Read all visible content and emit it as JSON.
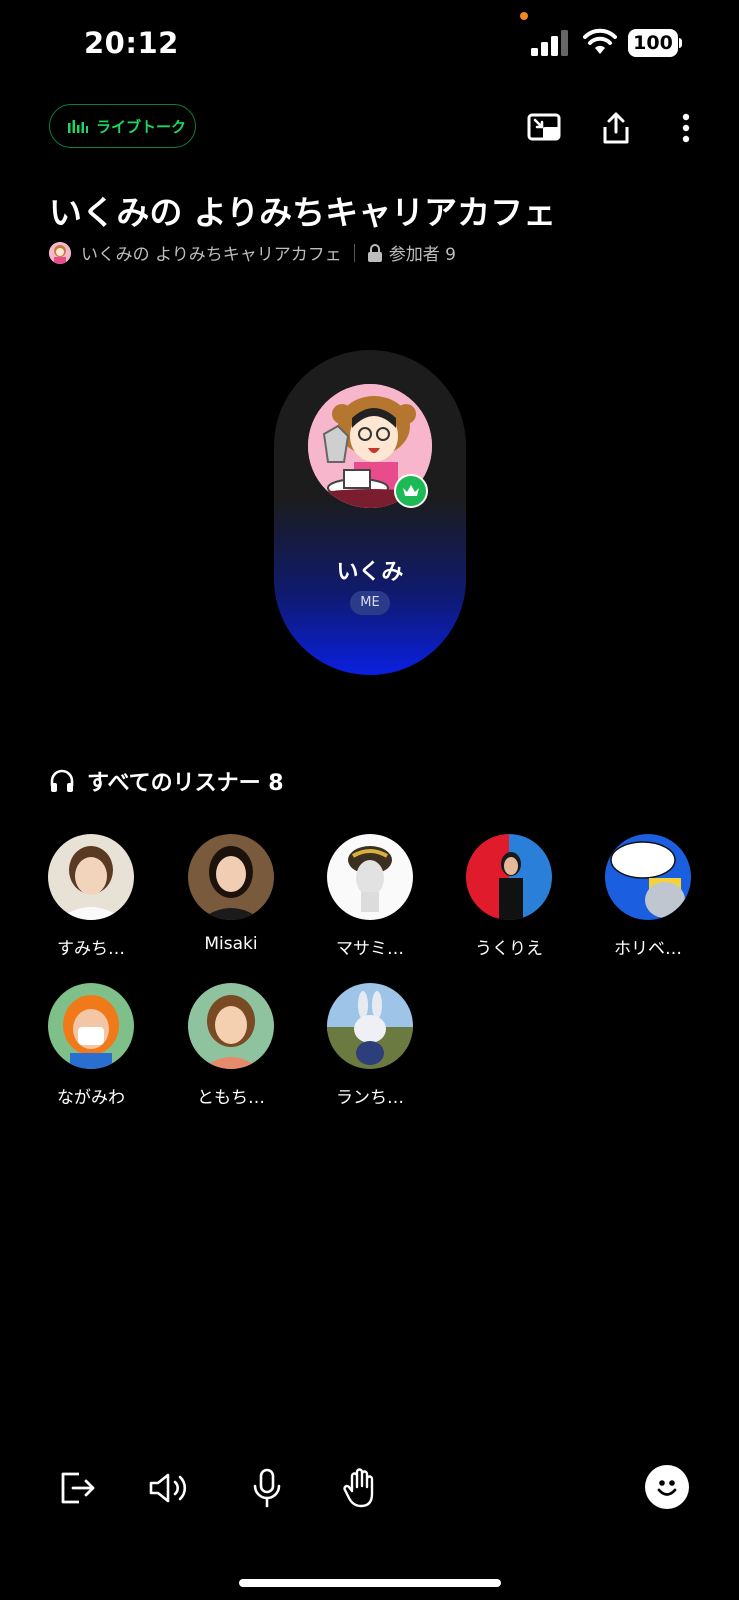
{
  "status_bar": {
    "time": "20:12",
    "battery": "100"
  },
  "header": {
    "live_badge": "ライブトーク",
    "room_title": "いくみの よりみちキャリアカフェ",
    "host_name": "いくみの よりみちキャリアカフェ",
    "participants": "参加者 9"
  },
  "speaker": {
    "name": "いくみ",
    "badge": "ME"
  },
  "listeners": {
    "heading": "すべてのリスナー 8",
    "items": [
      {
        "name": "すみち…"
      },
      {
        "name": "Misaki"
      },
      {
        "name": "マサミ…"
      },
      {
        "name": "うくりえ"
      },
      {
        "name": "ホリベ…"
      },
      {
        "name": "ながみわ"
      },
      {
        "name": "ともち…"
      },
      {
        "name": "ランち…"
      }
    ]
  },
  "icons": {
    "header": [
      "pip-icon",
      "share-icon",
      "more-icon"
    ],
    "bottom": [
      "exit-icon",
      "speaker-icon",
      "mic-icon",
      "raise-hand-icon",
      "emoji-icon"
    ]
  },
  "colors": {
    "accent_green": "#1ed760",
    "card_gradient_end": "#0a20e0",
    "background": "#000000"
  }
}
